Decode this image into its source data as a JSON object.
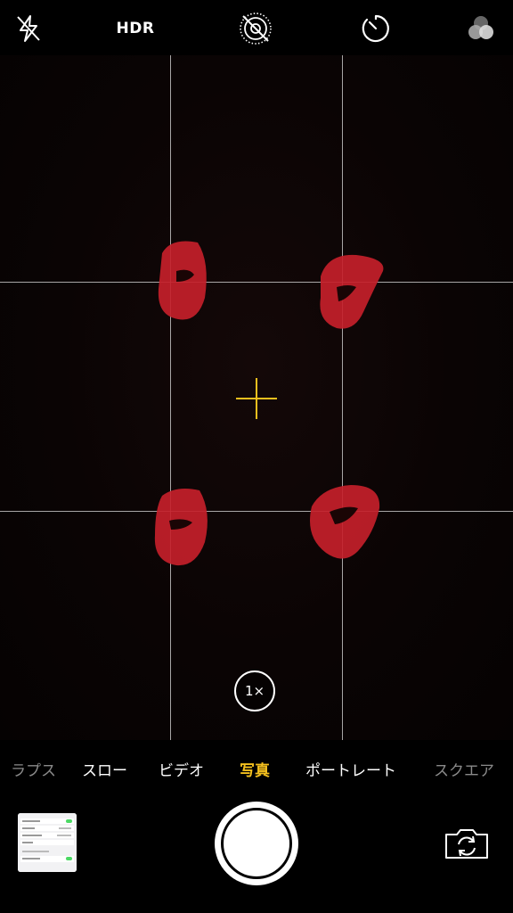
{
  "top_bar": {
    "flash_icon": "flash-off-icon",
    "hdr_label": "HDR",
    "live_photo_icon": "live-photo-off-icon",
    "timer_icon": "timer-icon",
    "filters_icon": "filters-icon"
  },
  "viewfinder": {
    "zoom_label": "1×",
    "focus_reticle_color": "#f4c01e",
    "grid_enabled": true
  },
  "modes": {
    "items": [
      {
        "label": "ラプス"
      },
      {
        "label": "スロー"
      },
      {
        "label": "ビデオ"
      },
      {
        "label": "写真"
      },
      {
        "label": "ポートレート"
      },
      {
        "label": "スクエア"
      }
    ],
    "selected": "写真",
    "accent_color": "#f4c01e"
  },
  "controls": {
    "thumbnail_icon": "last-photo-thumbnail",
    "shutter_icon": "shutter-button",
    "switch_camera_icon": "camera-switch-icon"
  }
}
